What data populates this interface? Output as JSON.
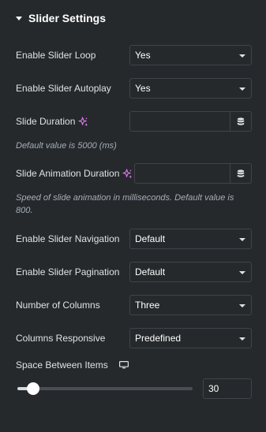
{
  "section": {
    "title": "Slider Settings"
  },
  "rows": {
    "loop": {
      "label": "Enable Slider Loop",
      "value": "Yes"
    },
    "autoplay": {
      "label": "Enable Slider Autoplay",
      "value": "Yes"
    },
    "duration": {
      "label": "Slide Duration",
      "value": "",
      "help": "Default value is 5000 (ms)"
    },
    "animation": {
      "label": "Slide Animation Duration",
      "value": "",
      "help": "Speed of slide animation in milliseconds. Default value is 800."
    },
    "navigation": {
      "label": "Enable Slider Navigation",
      "value": "Default"
    },
    "pagination": {
      "label": "Enable Slider Pagination",
      "value": "Default"
    },
    "columns": {
      "label": "Number of Columns",
      "value": "Three"
    },
    "responsive": {
      "label": "Columns Responsive",
      "value": "Predefined"
    }
  },
  "spacing": {
    "label": "Space Between Items",
    "value": "30",
    "fill_fraction": 0.09
  },
  "icons": {
    "ai": "sparkle-icon",
    "dynamic": "database-icon",
    "device": "desktop-icon",
    "collapse": "caret-down-icon",
    "dropdown": "chevron-down-icon"
  },
  "colors": {
    "background": "#26292c",
    "border": "#3f444b",
    "ai_accent": "#e37cf6",
    "help_text": "#a4afb7"
  }
}
